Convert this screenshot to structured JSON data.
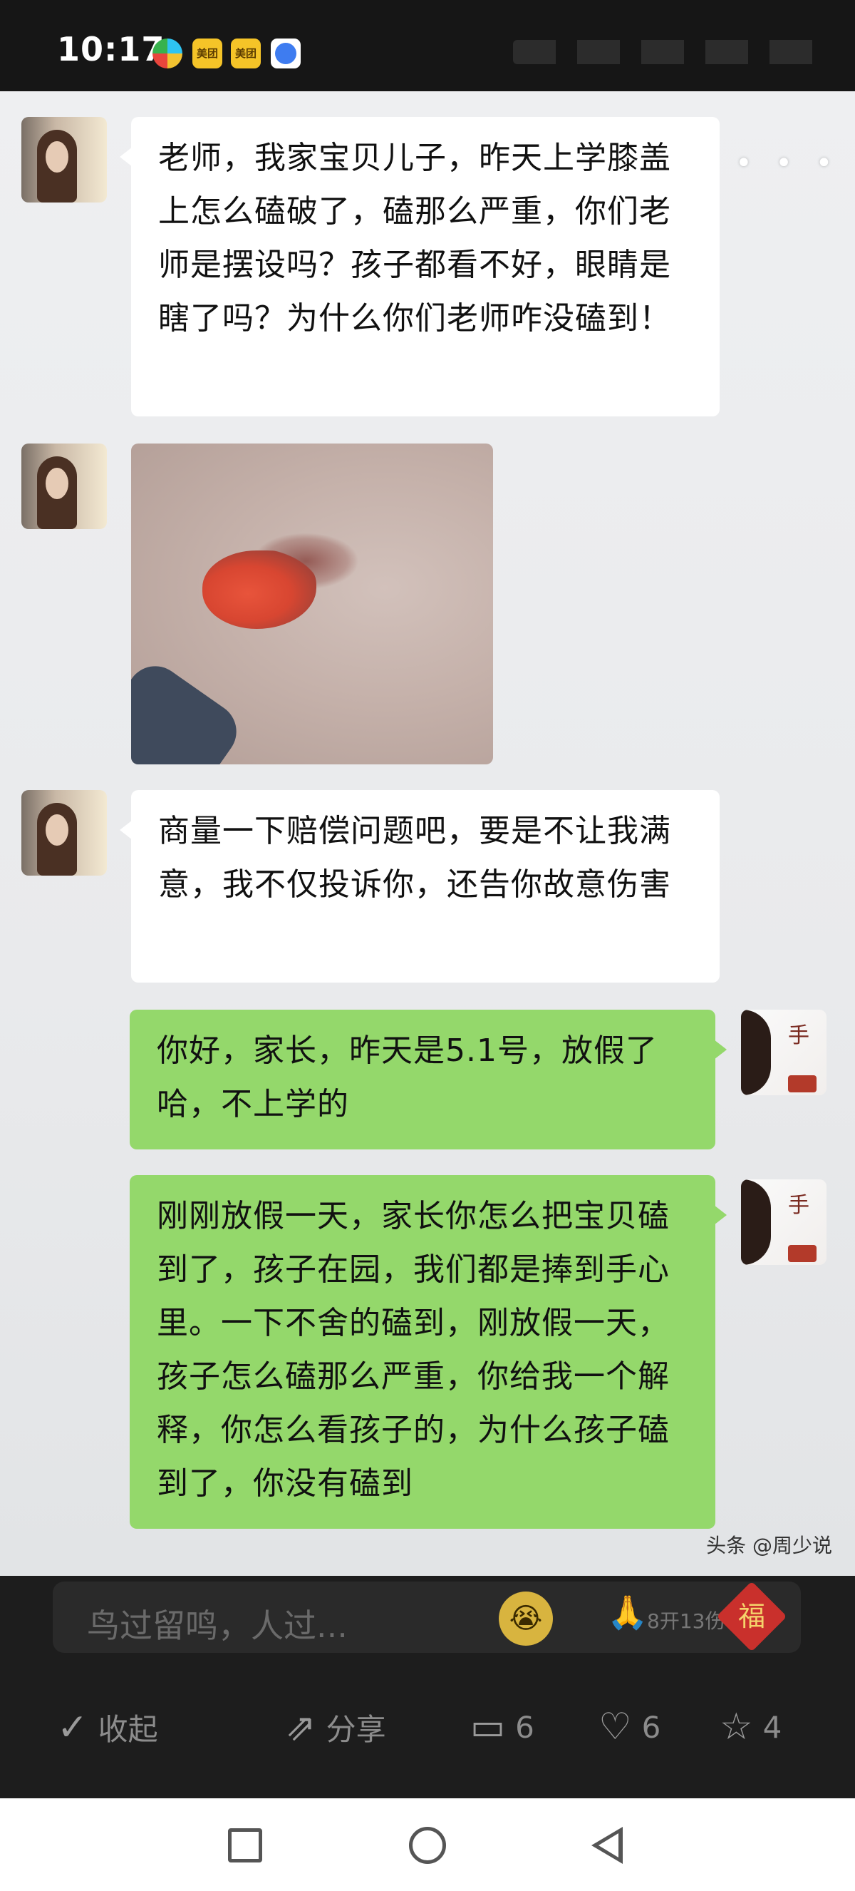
{
  "status_bar": {
    "time": "10:17",
    "icons": [
      "colorful-app-icon",
      "meituan-icon",
      "meituan-icon",
      "browser-icon"
    ],
    "meituan_label": "美团"
  },
  "chat": {
    "messages": [
      {
        "side": "left",
        "type": "text",
        "text": "老师，我家宝贝儿子，昨天上学膝盖上怎么磕破了，磕那么严重，你们老师是摆设吗？孩子都看不好，眼睛是瞎了吗？为什么你们老师咋没磕到！"
      },
      {
        "side": "left",
        "type": "image",
        "description_icon": "knee-wound-photo"
      },
      {
        "side": "left",
        "type": "text",
        "text": "商量一下赔偿问题吧，要是不让我满意，我不仅投诉你，还告你故意伤害"
      },
      {
        "side": "right",
        "type": "text",
        "text": "你好，家长，昨天是5.1号，放假了哈，不上学的"
      },
      {
        "side": "right",
        "type": "text",
        "text": "刚刚放假一天，家长你怎么把宝贝磕到了，孩子在园，我们都是捧到手心里。一下不舍的磕到，刚放假一天，孩子怎么磕那么严重，你给我一个解释，你怎么看孩子的，为什么孩子磕到了，你没有磕到"
      }
    ],
    "more_icon": "• • •",
    "watermark": "头条 @周少说"
  },
  "toolbar": {
    "comment_hint": "鸟过留鸣，人过...",
    "comment_emoji": "😭",
    "pray_emoji": "🙏",
    "reaction_count": "8开13伤",
    "fu_label": "福",
    "actions": [
      {
        "name": "collapse",
        "icon": "check-icon",
        "label": "收起"
      },
      {
        "name": "share",
        "icon": "share-icon",
        "label": "分享"
      },
      {
        "name": "comment",
        "icon": "comment-icon",
        "label": "6"
      },
      {
        "name": "like",
        "icon": "heart-icon",
        "label": "6"
      },
      {
        "name": "favorite",
        "icon": "star-icon",
        "label": "4"
      }
    ]
  },
  "colors": {
    "incoming_bubble": "#ffffff",
    "outgoing_bubble": "#94d86b",
    "chat_background": "#eeeff1",
    "toolbar_background": "#1d1d1d"
  }
}
